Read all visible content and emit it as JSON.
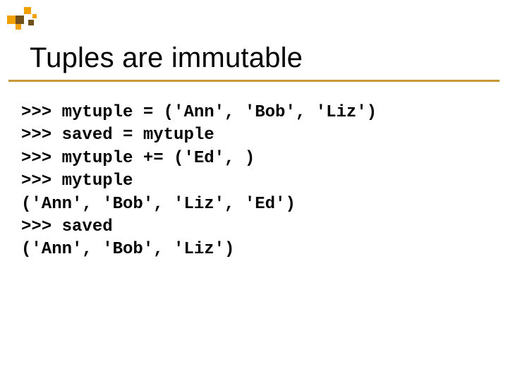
{
  "title": "Tuples are immutable",
  "code_lines": [
    ">>> mytuple = ('Ann', 'Bob', 'Liz')",
    ">>> saved = mytuple",
    ">>> mytuple += ('Ed', )",
    ">>> mytuple",
    "('Ann', 'Bob', 'Liz', 'Ed')",
    ">>> saved",
    "('Ann', 'Bob', 'Liz')"
  ]
}
